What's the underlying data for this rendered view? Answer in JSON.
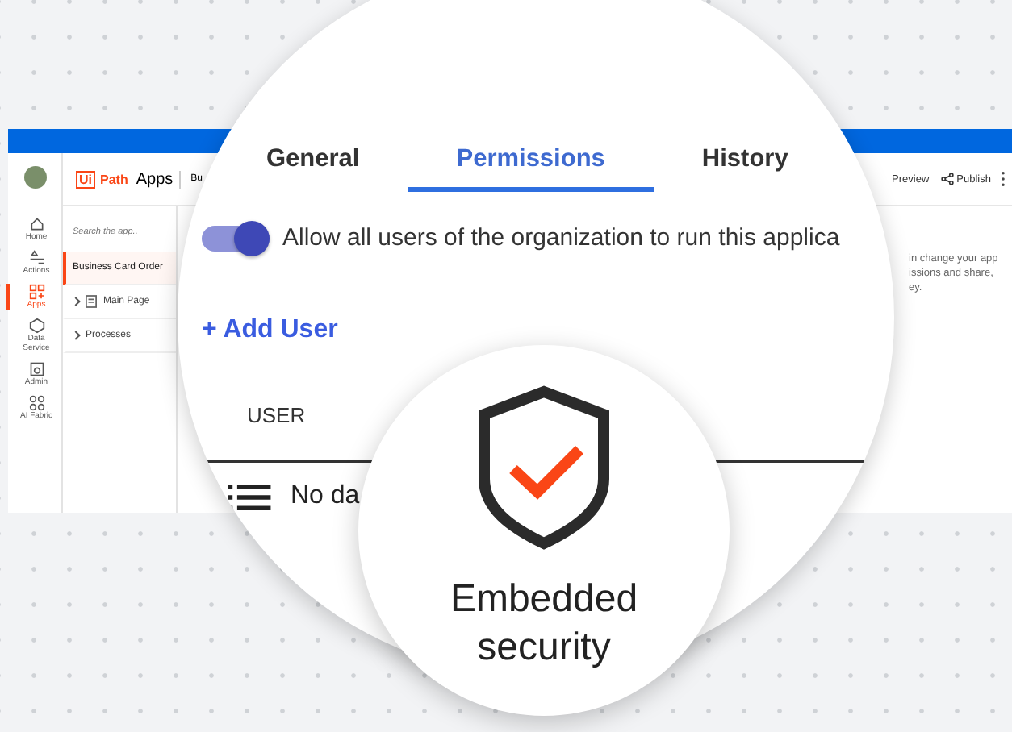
{
  "app": {
    "logo_mark": "Ui",
    "logo_text": "Path",
    "product": "Apps",
    "breadcrumb": "Bu",
    "actions": [
      "Preview",
      "Publish"
    ]
  },
  "rail": [
    {
      "label": "Home",
      "selected": false
    },
    {
      "label": "Actions",
      "selected": false
    },
    {
      "label": "Apps",
      "selected": true
    },
    {
      "label": "Data Service",
      "selected": false
    },
    {
      "label": "Admin",
      "selected": false
    },
    {
      "label": "AI Fabric",
      "selected": false
    }
  ],
  "tree": {
    "search_placeholder": "Search the app..",
    "items": [
      {
        "label": "Business Card Order",
        "kind": "app",
        "selected": true
      },
      {
        "label": "Main Page",
        "kind": "page",
        "selected": false
      },
      {
        "label": "Processes",
        "kind": "folder",
        "selected": false
      }
    ]
  },
  "side_note": [
    "in change your app",
    "issions and share,",
    "ey."
  ],
  "magnifier": {
    "tabs": [
      {
        "label": "General",
        "selected": false
      },
      {
        "label": "Permissions",
        "selected": true
      },
      {
        "label": "History",
        "selected": false
      }
    ],
    "toggle": {
      "label": "Allow all users of the organization to run this applica",
      "on": true
    },
    "add_user": "+ Add User",
    "columns": [
      "USER"
    ],
    "empty_text": "No da"
  },
  "badge": {
    "title": "Embedded security"
  }
}
